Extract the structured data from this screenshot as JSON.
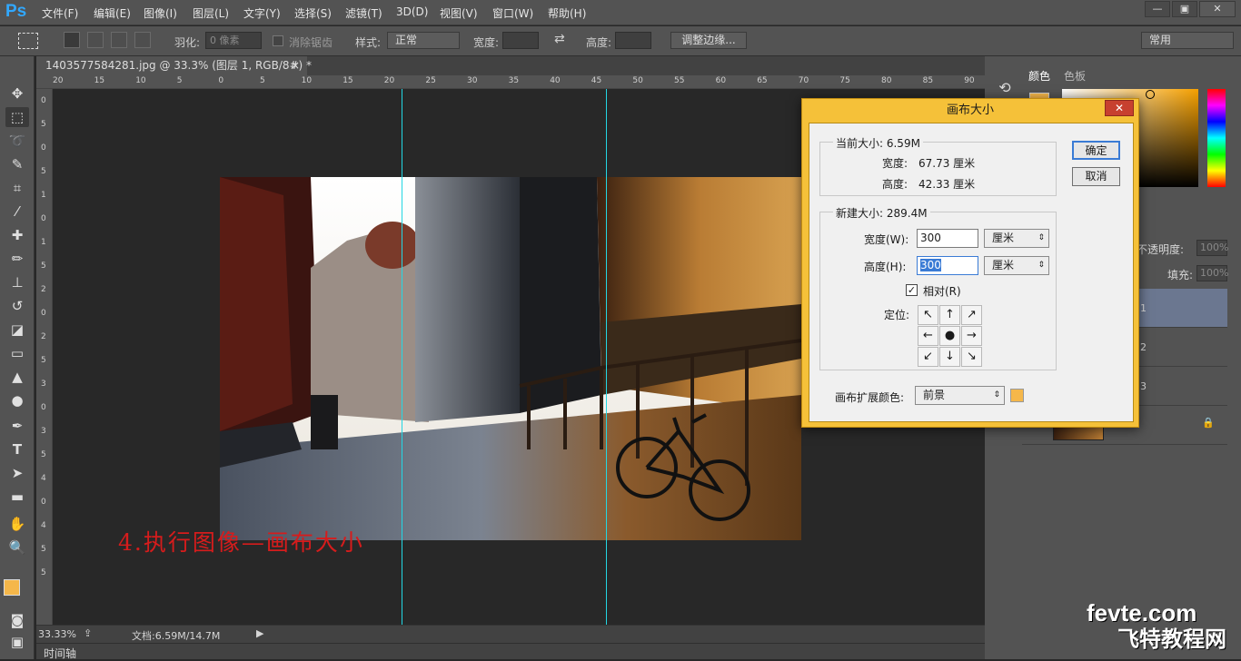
{
  "app": {
    "logo": "Ps"
  },
  "menu": [
    "文件(F)",
    "编辑(E)",
    "图像(I)",
    "图层(L)",
    "文字(Y)",
    "选择(S)",
    "滤镜(T)",
    "3D(D)",
    "视图(V)",
    "窗口(W)",
    "帮助(H)"
  ],
  "window_controls": {
    "minimize": "—",
    "restore": "▣",
    "close": "✕"
  },
  "options": {
    "feather_label": "羽化:",
    "feather_value": "0 像素",
    "antialias_label": "消除锯齿",
    "style_label": "样式:",
    "style_value": "正常",
    "width_label": "宽度:",
    "height_label": "高度:",
    "refine_edge": "调整边缘...",
    "workspace": "常用"
  },
  "document_tab": {
    "title": "1403577584281.jpg @ 33.3% (图层 1, RGB/8#) *",
    "close": "×"
  },
  "ruler_h": [
    "20",
    "15",
    "10",
    "5",
    "0",
    "5",
    "10",
    "15",
    "20",
    "25",
    "30",
    "35",
    "40",
    "45",
    "50",
    "55",
    "60",
    "65",
    "70",
    "75",
    "80",
    "85",
    "90",
    "95"
  ],
  "ruler_v": [
    "0",
    "5",
    "0",
    "5",
    "1",
    "0",
    "1",
    "5",
    "2",
    "0",
    "2",
    "5",
    "3",
    "0",
    "3",
    "5",
    "4",
    "0",
    "4",
    "5",
    "5"
  ],
  "annotation": "4.执行图像—画布大小",
  "status": {
    "zoom": "33.33%",
    "doc": "文档:6.59M/14.7M"
  },
  "timeline": "时间轴",
  "color_panel": {
    "tab1": "颜色",
    "tab2": "色板"
  },
  "layers_panel": {
    "opacity_label": "不透明度:",
    "opacity_value": "100%",
    "fill_label": "填充:",
    "fill_value": "100%",
    "rows": [
      "1",
      "2",
      "3"
    ]
  },
  "dialog": {
    "title": "画布大小",
    "close": "✕",
    "current_label": "当前大小: 6.59M",
    "cur_width_label": "宽度:",
    "cur_width_value": "67.73 厘米",
    "cur_height_label": "高度:",
    "cur_height_value": "42.33 厘米",
    "new_label": "新建大小: 289.4M",
    "new_width_label": "宽度(W):",
    "new_width_value": "300",
    "new_width_unit": "厘米",
    "new_height_label": "高度(H):",
    "new_height_value": "300",
    "new_height_unit": "厘米",
    "relative_label": "相对(R)",
    "anchor_label": "定位:",
    "ext_color_label": "画布扩展颜色:",
    "ext_color_value": "前景",
    "ok": "确定",
    "cancel": "取消"
  },
  "colors": {
    "foreground": "#f5b74a",
    "background": "#000000",
    "guide": "#23d7e4",
    "annotation": "#d61c1c"
  },
  "watermark": {
    "line1": "fevte.com",
    "line2": "飞特教程网"
  }
}
